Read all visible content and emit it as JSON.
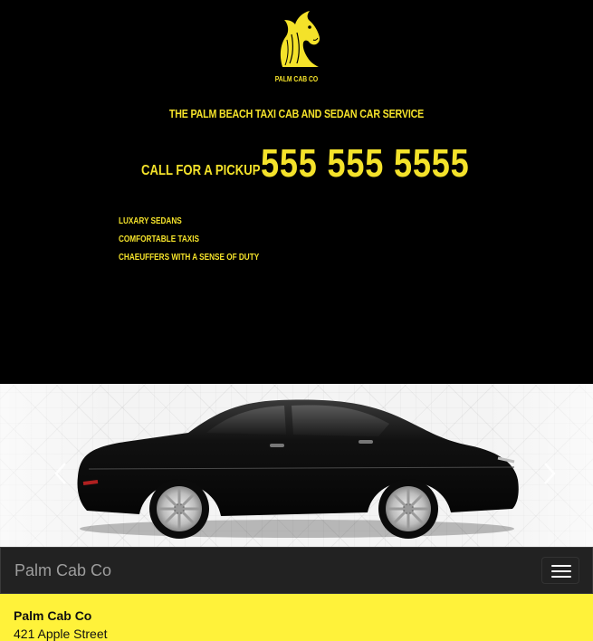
{
  "header": {
    "brand_small": "PALM CAB CO",
    "tagline": "THE PALM BEACH TAXI CAB AND SEDAN CAR SERVICE",
    "call_label": "CALL FOR A PICKUP",
    "phone": "555 555 5555",
    "features": [
      {
        "label": "LUXARY SEDANS"
      },
      {
        "label": "COMFORTABLE TAXIS"
      },
      {
        "label": "CHAEUFFERS WITH A SENSE OF DUTY"
      }
    ],
    "logo_icon": "horse-head-icon"
  },
  "carousel": {
    "image_subject": "black-sedan",
    "prev_icon": "chevron-left-icon",
    "next_icon": "chevron-right-icon"
  },
  "navbar": {
    "brand": "Palm Cab Co",
    "toggle_icon": "hamburger-menu-icon"
  },
  "info": {
    "name": "Palm Cab Co",
    "address": "421 Apple Street"
  },
  "colors": {
    "accent_yellow": "#f4e22a",
    "info_bar": "#fff23a",
    "navbar": "#222222",
    "background": "#000000"
  }
}
